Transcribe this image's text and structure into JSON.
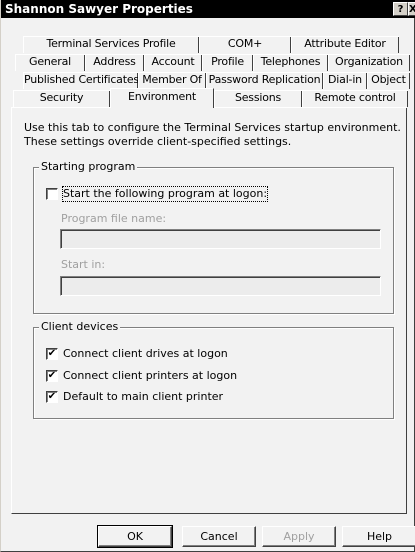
{
  "window": {
    "title": "Shannon Sawyer Properties",
    "help_button": "?",
    "close_button": "X"
  },
  "tabs": {
    "row1": [
      "Terminal Services Profile",
      "COM+",
      "Attribute Editor"
    ],
    "row2": [
      "General",
      "Address",
      "Account",
      "Profile",
      "Telephones",
      "Organization"
    ],
    "row3": [
      "Published Certificates",
      "Member Of",
      "Password Replication",
      "Dial-in",
      "Object"
    ],
    "row4": [
      "Security",
      "Environment",
      "Sessions",
      "Remote control"
    ],
    "active": "Environment"
  },
  "description": "Use this tab to configure the Terminal Services startup environment. These settings override client-specified settings.",
  "starting_program": {
    "title": "Starting program",
    "checkbox_label": "Start the following program at logon:",
    "checked": false,
    "program_label": "Program file name:",
    "program_value": "",
    "startin_label": "Start in:",
    "startin_value": ""
  },
  "client_devices": {
    "title": "Client devices",
    "items": [
      {
        "label": "Connect client drives at logon",
        "checked": true
      },
      {
        "label": "Connect client printers at logon",
        "checked": true
      },
      {
        "label": "Default to main client printer",
        "checked": true
      }
    ]
  },
  "buttons": {
    "ok": "OK",
    "cancel": "Cancel",
    "apply": "Apply",
    "help": "Help"
  },
  "check_mark": "✔"
}
